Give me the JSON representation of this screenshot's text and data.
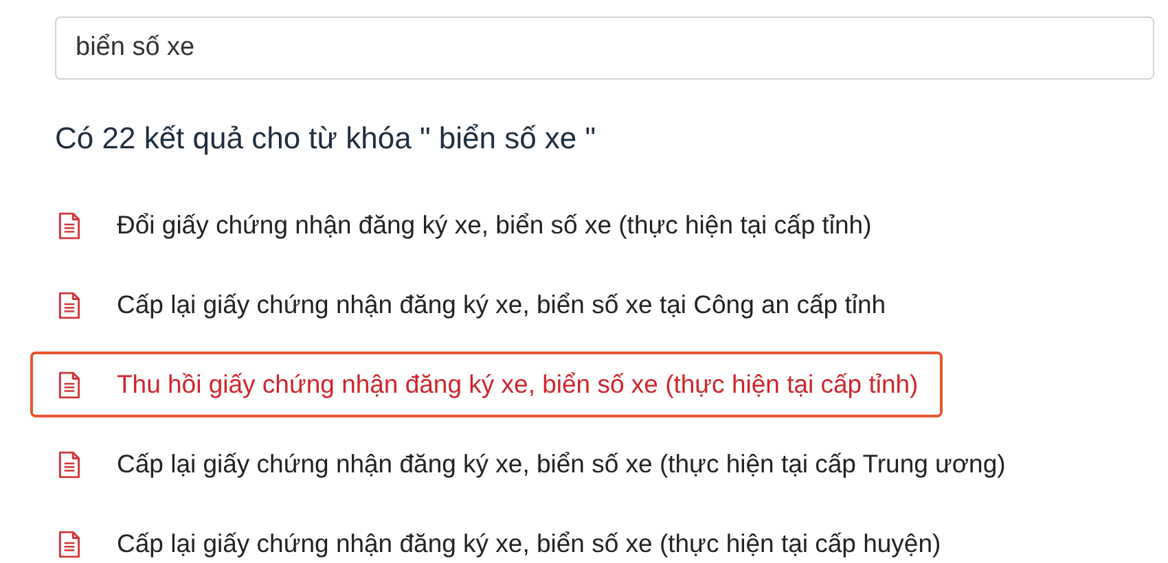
{
  "search": {
    "value": "biển số xe"
  },
  "heading": "Có 22 kết quả cho từ khóa \" biển số xe \"",
  "results": [
    {
      "title": "Đổi giấy chứng nhận đăng ký xe, biển số xe (thực hiện tại cấp tỉnh)",
      "highlighted": false
    },
    {
      "title": "Cấp lại giấy chứng nhận đăng ký xe, biển số xe tại Công an cấp tỉnh",
      "highlighted": false
    },
    {
      "title": "Thu hồi giấy chứng nhận đăng ký xe, biển số xe (thực hiện tại cấp tỉnh)",
      "highlighted": true
    },
    {
      "title": "Cấp lại giấy chứng nhận đăng ký xe, biển số xe (thực hiện tại cấp Trung ương)",
      "highlighted": false
    },
    {
      "title": "Cấp lại giấy chứng nhận đăng ký xe, biển số xe (thực hiện tại cấp huyện)",
      "highlighted": false
    }
  ]
}
